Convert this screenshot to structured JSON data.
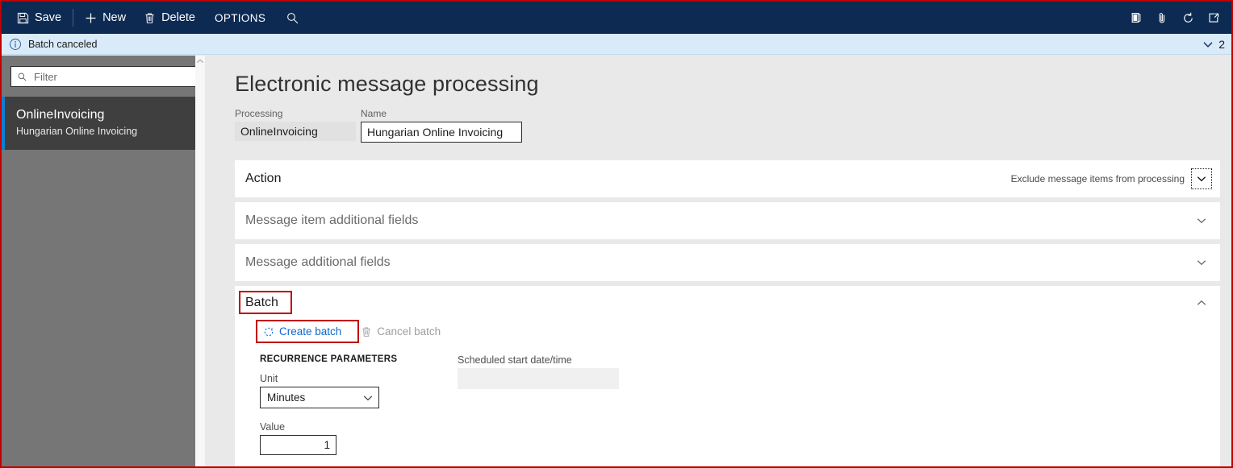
{
  "toolbar": {
    "save_label": "Save",
    "new_label": "New",
    "delete_label": "Delete",
    "options_label": "OPTIONS",
    "search_icon": "search-icon",
    "right_icons": [
      "office-app-icon",
      "attachment-icon",
      "refresh-icon",
      "open-in-new-window-icon"
    ],
    "background": "#0d2a52"
  },
  "message_bar": {
    "icon": "info-icon",
    "text": "Batch canceled",
    "count": "2",
    "chevron": "chevron-down-icon",
    "background": "#d9eaf9"
  },
  "sidebar": {
    "filter_placeholder": "Filter",
    "filter_value": "",
    "filter_icon": "search-icon",
    "scroll_up_arrow": "⌃",
    "items": [
      {
        "title": "OnlineInvoicing",
        "subtitle": "Hungarian Online Invoicing",
        "selected": true,
        "accent": "#0f7fd4"
      }
    ]
  },
  "page": {
    "title": "Electronic message processing",
    "fields": {
      "processing": {
        "label": "Processing",
        "value": "OnlineInvoicing",
        "readonly": true
      },
      "name": {
        "label": "Name",
        "value": "Hungarian Online Invoicing",
        "readonly": false
      }
    }
  },
  "panels": [
    {
      "title": "Action",
      "summary": "Exclude message items from processing",
      "chevron": "chevron-down-icon",
      "active": true,
      "focused": true
    },
    {
      "title": "Message item additional fields",
      "summary": "",
      "chevron": "chevron-down-icon",
      "active": false,
      "focused": false
    },
    {
      "title": "Message additional fields",
      "summary": "",
      "chevron": "chevron-down-icon",
      "active": false,
      "focused": false
    }
  ],
  "batch": {
    "title": "Batch",
    "chevron": "chevron-up-icon",
    "create_button": {
      "label": "Create batch",
      "icon": "refresh-spinner-icon",
      "enabled": true
    },
    "cancel_button": {
      "label": "Cancel batch",
      "icon": "trash-icon",
      "enabled": false
    },
    "group_title": "RECURRENCE PARAMETERS",
    "unit": {
      "label": "Unit",
      "value": "Minutes",
      "chevron": "chevron-down-icon"
    },
    "value": {
      "label": "Value",
      "value": "1"
    },
    "scheduled": {
      "label": "Scheduled start date/time",
      "value": ""
    }
  },
  "annotations": {
    "color": "#c00000",
    "boxes": [
      "batch-title-highlight",
      "create-batch-highlight",
      "page-border-highlight"
    ]
  }
}
